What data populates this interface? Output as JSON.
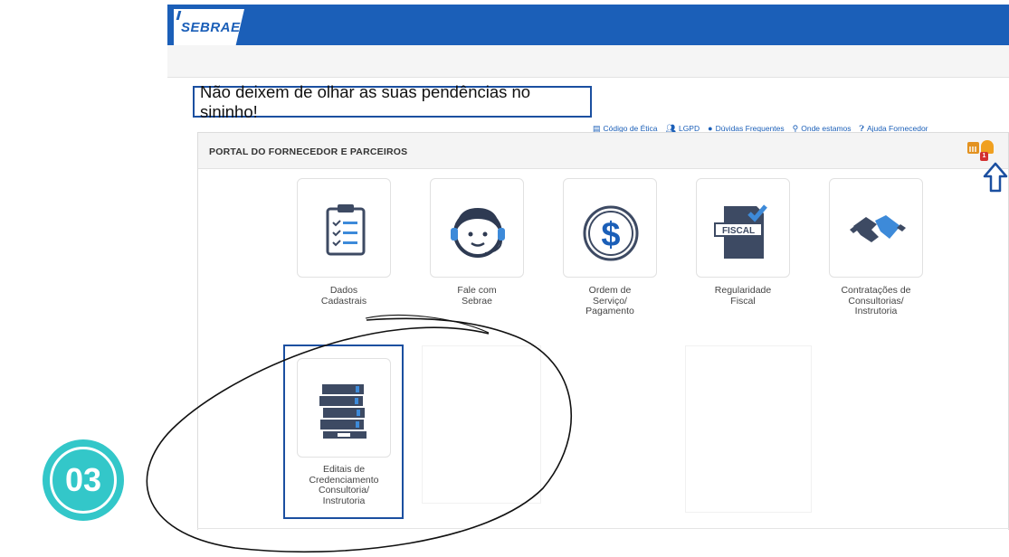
{
  "header": {
    "logo_text": "SEBRAE",
    "brand_color": "#1b5fb8"
  },
  "notice": {
    "text": "Não deixem de olhar as suas pendências no sininho!"
  },
  "top_links": [
    {
      "icon": "book-icon",
      "label": "Código de Ética"
    },
    {
      "icon": "users-icon",
      "label": "LGPD"
    },
    {
      "icon": "chat-icon",
      "label": "Dúvidas Frequentes"
    },
    {
      "icon": "map-pin-icon",
      "label": "Onde estamos"
    },
    {
      "icon": "help-circle-icon",
      "label": "Ajuda Fornecedor"
    }
  ],
  "portal": {
    "title": "PORTAL DO FORNECEDOR E PARCEIROS",
    "notification_count": "1",
    "cards": [
      {
        "icon": "clipboard-checklist-icon",
        "label_lines": [
          "Dados",
          "Cadastrais"
        ]
      },
      {
        "icon": "support-agent-icon",
        "label_lines": [
          "Fale com",
          "Sebrae"
        ]
      },
      {
        "icon": "dollar-coin-icon",
        "label_lines": [
          "Ordem de",
          "Serviço/",
          "Pagamento"
        ]
      },
      {
        "icon": "fiscal-document-icon",
        "label_lines": [
          "Regularidade",
          "Fiscal"
        ],
        "icon_text": "FISCAL"
      },
      {
        "icon": "handshake-icon",
        "label_lines": [
          "Contratações de",
          "Consultorias/",
          "Instrutoria"
        ]
      },
      {
        "icon": "binders-stack-icon",
        "label_lines": [
          "Editais de",
          "Credenciamento",
          "Consultoria/",
          "Instrutoria"
        ]
      }
    ]
  },
  "step": {
    "number": "03",
    "color": "#33c7c9"
  }
}
